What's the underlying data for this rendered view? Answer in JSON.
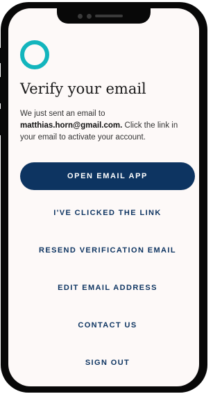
{
  "verify": {
    "title": "Verify your email",
    "desc_prefix": "We just sent an email to",
    "email": "matthias.horn@gmail.com.",
    "desc_suffix": "Click the link in your email to activate your account."
  },
  "actions": {
    "open_email_app": "OPEN EMAIL APP",
    "clicked_link": "I'VE CLICKED THE LINK",
    "resend": "RESEND VERIFICATION EMAIL",
    "edit_email": "EDIT EMAIL ADDRESS",
    "contact": "CONTACT US",
    "sign_out": "SIGN OUT"
  },
  "colors": {
    "brand_teal": "#13b5bd",
    "primary_navy": "#0d3461",
    "screen_background": "#fdf9f8",
    "device_frame": "#080808"
  },
  "icons": {
    "logo": "teal-ring-logo"
  }
}
